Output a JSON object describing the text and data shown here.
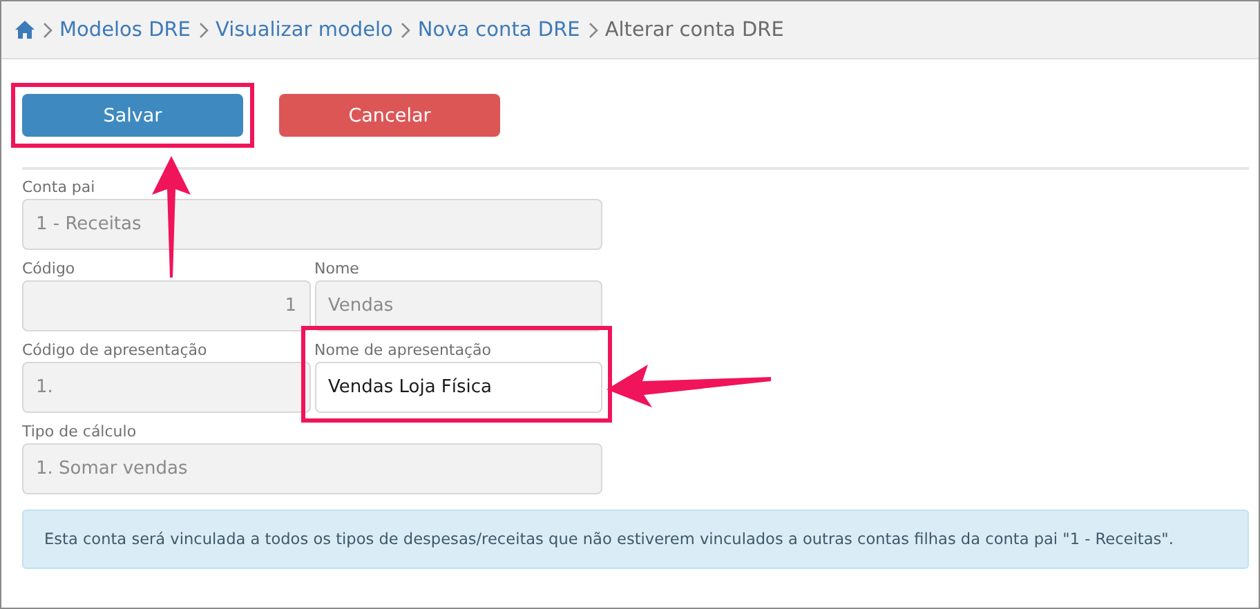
{
  "breadcrumb": [
    {
      "label": "Modelos DRE",
      "current": false
    },
    {
      "label": "Visualizar modelo",
      "current": false
    },
    {
      "label": "Nova conta DRE",
      "current": false
    },
    {
      "label": "Alterar conta DRE",
      "current": true
    }
  ],
  "buttons": [
    {
      "label": "Salvar",
      "kind": "primary",
      "highlighted": true,
      "callout_arrow": true
    },
    {
      "label": "Cancelar",
      "kind": "danger",
      "highlighted": false
    }
  ],
  "form_rows": [
    [
      {
        "label": "Conta pai",
        "value": "1 - Receitas",
        "kind": "text",
        "disabled": true,
        "highlighted": false
      }
    ],
    [
      {
        "label": "Código",
        "value": "1",
        "kind": "number",
        "disabled": true,
        "highlighted": false
      },
      {
        "label": "Nome",
        "value": "Vendas",
        "kind": "text",
        "disabled": true,
        "highlighted": false
      }
    ],
    [
      {
        "label": "Código de apresentação",
        "value": "1.",
        "kind": "text",
        "disabled": true,
        "highlighted": false
      },
      {
        "label": "Nome de apresentação",
        "value": "Vendas Loja Física",
        "kind": "text",
        "disabled": false,
        "highlighted": true,
        "callout_arrow": true
      }
    ],
    [
      {
        "label": "Tipo de cálculo",
        "value": "1. Somar vendas",
        "kind": "text",
        "disabled": true,
        "highlighted": false
      }
    ]
  ],
  "info": "Esta conta será vinculada a todos os tipos de despesas/receitas que não estiverem vinculados a outras contas filhas da conta pai \"1 - Receitas\"."
}
